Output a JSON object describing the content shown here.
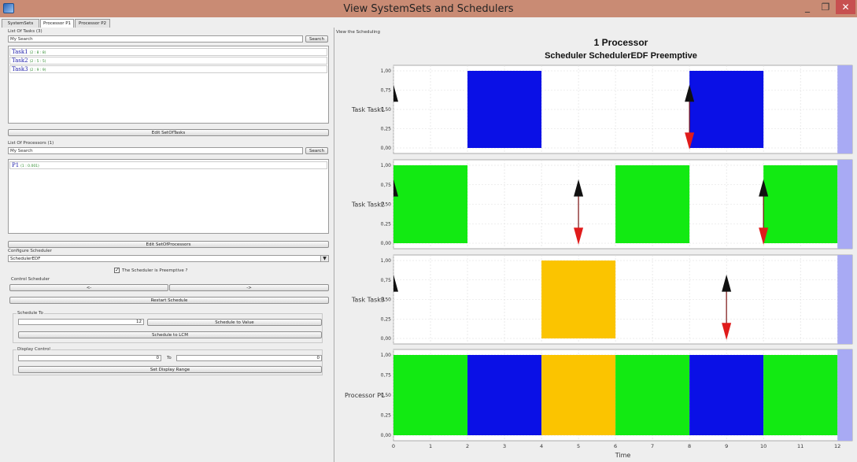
{
  "window": {
    "title": "View SystemSets and Schedulers",
    "min": "_",
    "max": "❐",
    "close": "✕"
  },
  "tabs": [
    {
      "label": "SystemSets",
      "active": false
    },
    {
      "label": "Processor P1",
      "active": true
    },
    {
      "label": "Processor P2",
      "active": false
    }
  ],
  "left": {
    "tasks_label": "List Of Tasks (3)",
    "tasks_search_value": "My Search",
    "search_label": "Search",
    "tasks": [
      {
        "name": "Task1",
        "params": "(2 : 8 : 8)"
      },
      {
        "name": "Task2",
        "params": "(2 : 5 : 5)"
      },
      {
        "name": "Task3",
        "params": "(2 : 9 : 9)"
      }
    ],
    "edit_tasks_label": "Edit SetOfTasks",
    "processors_label": "List Of Processors (1)",
    "processors_search_value": "My Search",
    "processors": [
      {
        "name": "P1",
        "params": "(1 : 0.001)"
      }
    ],
    "edit_processors_label": "Edit SetOfProcessors",
    "configure_label": "Configure Scheduler",
    "scheduler_value": "SchedulerEDF",
    "preemptive_label": "The Scheduler is Preemptive ?",
    "preemptive_checked": true,
    "control_label": "Control Scheduler",
    "back_label": "<-",
    "forward_label": "->",
    "restart_label": "Restart Schedule",
    "schedule_to_label": "Schedule To",
    "schedule_to_value": "12",
    "schedule_to_value_btn": "Schedule to Value",
    "schedule_lcm_label": "Schedule to LCM",
    "display_control_label": "Display Control",
    "display_from": "0",
    "to_label": "To",
    "display_to": "0",
    "set_display_label": "Set Display Range"
  },
  "right": {
    "view_label": "View the Scheduling"
  },
  "chart_data": {
    "type": "gantt",
    "title": "1 Processor",
    "subtitle": "Scheduler SchedulerEDF Preemptive",
    "xlabel": "Time",
    "xlim": [
      0,
      12.4
    ],
    "xticks": [
      0,
      1,
      2,
      3,
      4,
      5,
      6,
      7,
      8,
      9,
      10,
      11,
      12
    ],
    "ylim": [
      0,
      1
    ],
    "yticks": [
      "0,00",
      "0,25",
      "0,50",
      "0,75",
      "1,00"
    ],
    "grid": true,
    "end_marker": {
      "from": 12,
      "to": 12.4,
      "color": "#a8aaf4"
    },
    "colors": {
      "Task1": "#0a10e6",
      "Task2": "#12ea12",
      "Task3": "#fbc400",
      "arrow_up": "#111111",
      "arrow_down": "#e01b1b"
    },
    "rows": [
      {
        "label": "Task Task1",
        "segments": [
          {
            "start": 2,
            "end": 4,
            "task": "Task1"
          },
          {
            "start": 8,
            "end": 10,
            "task": "Task1"
          }
        ],
        "releases": [
          0,
          8
        ],
        "deadlines": [
          8
        ]
      },
      {
        "label": "Task Task2",
        "segments": [
          {
            "start": 0,
            "end": 2,
            "task": "Task2"
          },
          {
            "start": 6,
            "end": 8,
            "task": "Task2"
          },
          {
            "start": 10,
            "end": 12,
            "task": "Task2"
          }
        ],
        "releases": [
          0,
          5,
          10
        ],
        "deadlines": [
          5,
          10
        ]
      },
      {
        "label": "Task Task3",
        "segments": [
          {
            "start": 4,
            "end": 6,
            "task": "Task3"
          }
        ],
        "releases": [
          0,
          9
        ],
        "deadlines": [
          9
        ]
      },
      {
        "label": "Processor P1",
        "segments": [
          {
            "start": 0,
            "end": 2,
            "task": "Task2"
          },
          {
            "start": 2,
            "end": 4,
            "task": "Task1"
          },
          {
            "start": 4,
            "end": 6,
            "task": "Task3"
          },
          {
            "start": 6,
            "end": 8,
            "task": "Task2"
          },
          {
            "start": 8,
            "end": 10,
            "task": "Task1"
          },
          {
            "start": 10,
            "end": 12,
            "task": "Task2"
          }
        ],
        "releases": [],
        "deadlines": []
      }
    ]
  }
}
